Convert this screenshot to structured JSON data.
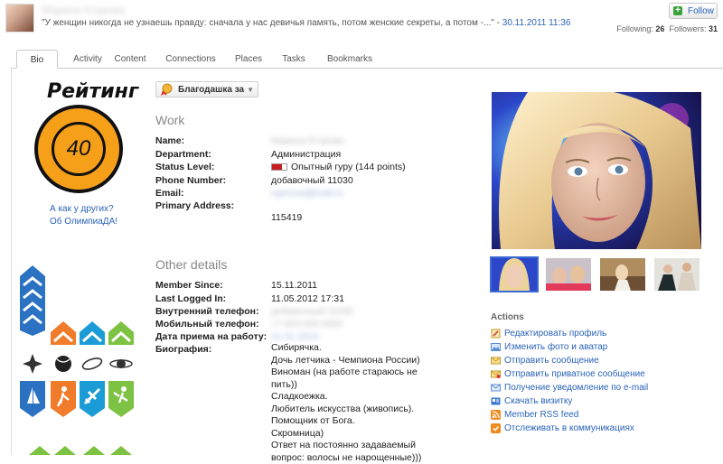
{
  "header": {
    "user_name": "Марина Егорова",
    "status_text": "\"У женщин никогда не узнаешь правду: сначала у нас девичья память, потом женские секреты, а потом -...\"",
    "status_sep": " - ",
    "status_date": "30.11.2011 11:36",
    "follow_label": "Follow",
    "following_label": "Following:",
    "following_count": "26",
    "followers_label": "Followers:",
    "followers_count": "31"
  },
  "tabs": [
    "Bio",
    "Activity",
    "Content",
    "Connections",
    "Places",
    "Tasks",
    "Bookmarks"
  ],
  "rating": {
    "title": "Рейтинг",
    "value": "40",
    "link_compare": "А как у других?",
    "link_about": "Об ОлимпиаДА!"
  },
  "thanks_button": "Благодашка за",
  "work": {
    "title": "Work",
    "fields": [
      {
        "label": "Name:",
        "value": "Марина Егорова"
      },
      {
        "label": "Department:",
        "value": "Администрация"
      },
      {
        "label": "Status Level:",
        "value": "Опытный гуру (144 points)"
      },
      {
        "label": "Phone Number:",
        "value": "добавочный 11030"
      },
      {
        "label": "Email:",
        "value": "egorova@mail.ru"
      },
      {
        "label": "Primary Address:",
        "value": ""
      }
    ],
    "address_postcode": "115419"
  },
  "other": {
    "title": "Other details",
    "fields": [
      {
        "label": "Member Since:",
        "value": "15.11.2011"
      },
      {
        "label": "Last Logged In:",
        "value": "11.05.2012 17:31"
      },
      {
        "label": "Внутренний телефон:",
        "value": "добавочный 11030"
      },
      {
        "label": "Мобильный телефон:",
        "value": "+7 903 000 0000"
      },
      {
        "label": "Дата приема на работу:",
        "value": "01.01.2010"
      },
      {
        "label": "Биография:",
        "value": ""
      }
    ],
    "bio_lines": [
      "Сибирячка.",
      "Дочь летчика - Чемпиона России)",
      "Виноман (на работе стараюсь не пить))",
      "Сладкоежка.",
      "Любитель искусства (живопись).",
      "Помощник от Бога.",
      "Скромница)",
      "Ответ на постоянно задаваемый вопрос: волосы не нарощенные)))"
    ]
  },
  "actions": {
    "title": "Actions",
    "items": [
      {
        "label": "Редактировать профиль",
        "icon": "pencil-icon",
        "color": "#e0a020"
      },
      {
        "label": "Изменить фото и аватар",
        "icon": "photo-icon",
        "color": "#5b8fd6"
      },
      {
        "label": "Отправить сообщение",
        "icon": "envelope-icon",
        "color": "#e7b53a"
      },
      {
        "label": "Отправить приватное сообщение",
        "icon": "private-message-icon",
        "color": "#e7b53a"
      },
      {
        "label": "Получение уведомление по e-mail",
        "icon": "email-notify-icon",
        "color": "#5b8fd6"
      },
      {
        "label": "Скачать визитку",
        "icon": "vcard-icon",
        "color": "#3a7ad0"
      },
      {
        "label": "Member RSS feed",
        "icon": "rss-icon",
        "color": "#f08a1c"
      },
      {
        "label": "Отслеживать в коммуникациях",
        "icon": "track-icon",
        "color": "#f08a1c"
      }
    ]
  },
  "colors": {
    "link": "#2a63b8",
    "rating_orange": "#f6a01a",
    "badge_blue": "#2b72c3",
    "badge_orange": "#f07b2a",
    "badge_teal": "#1b9cd6",
    "badge_green": "#7dc242"
  }
}
